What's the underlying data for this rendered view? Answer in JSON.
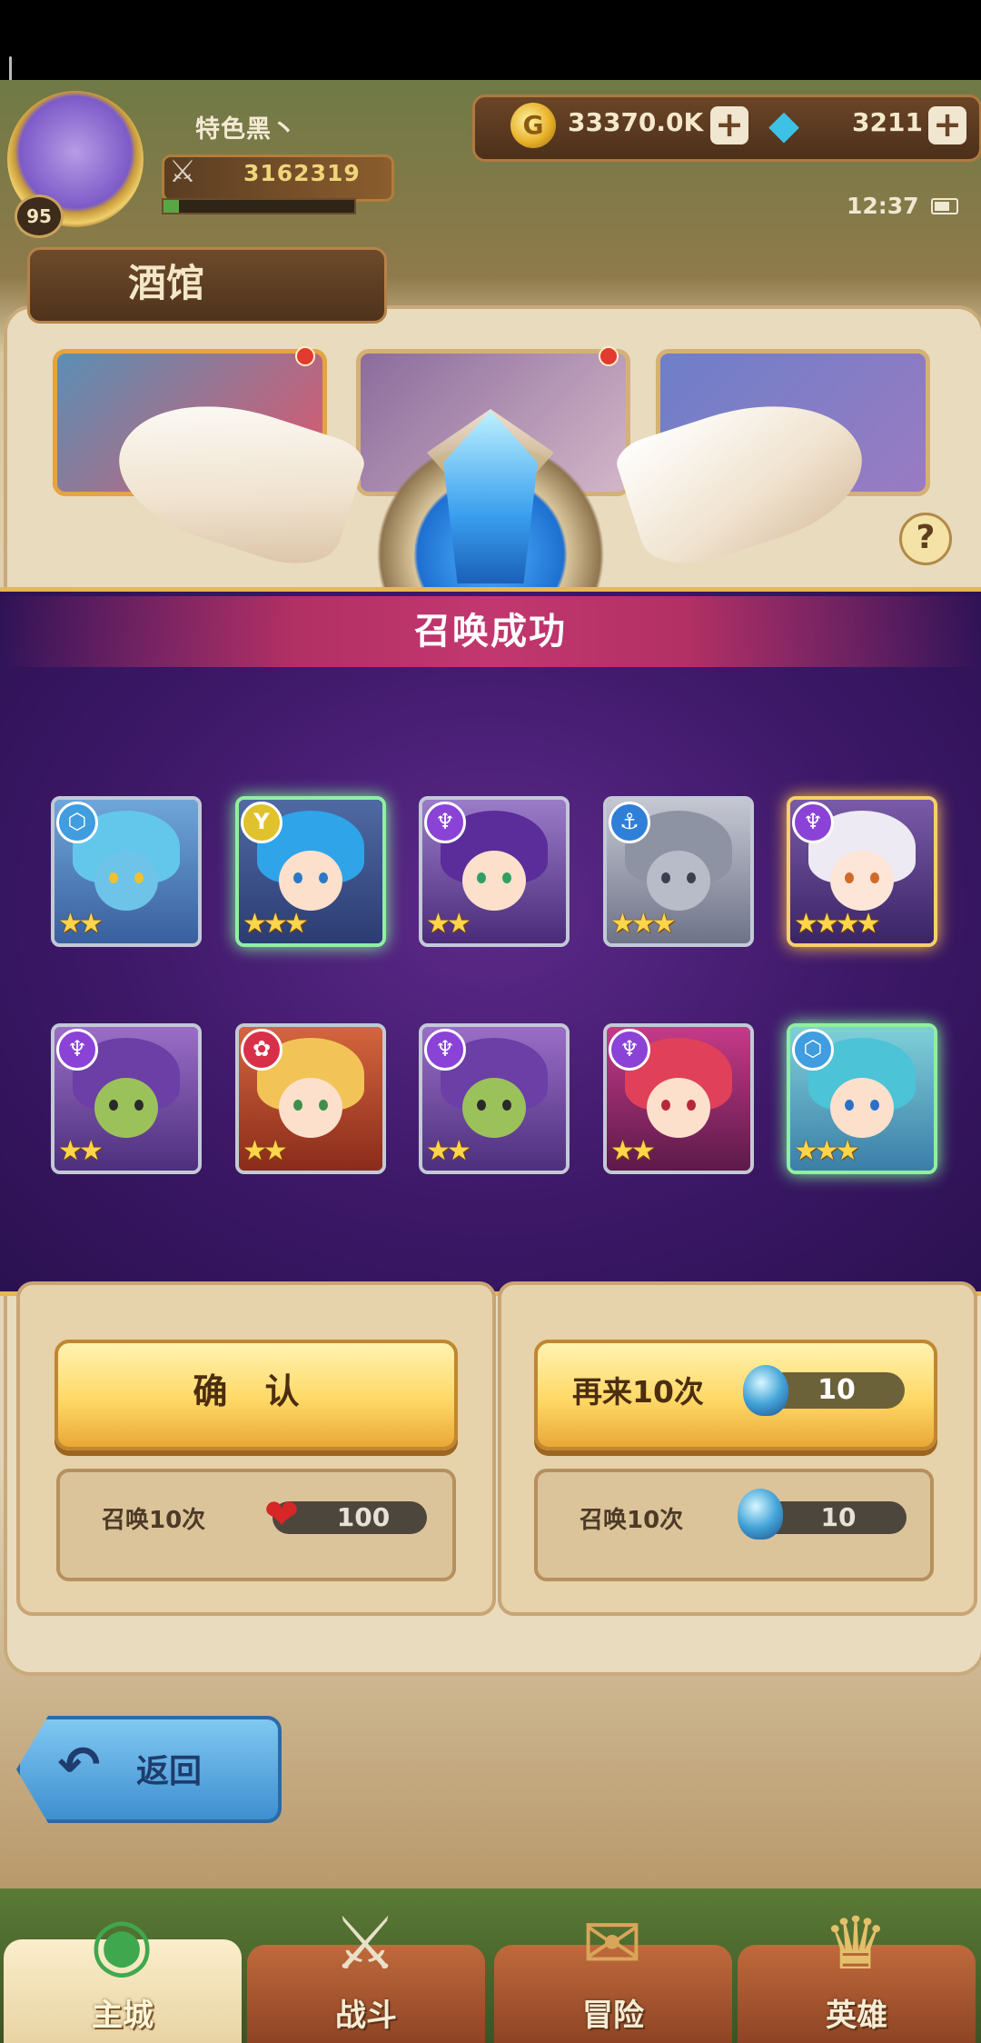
{
  "player": {
    "name": "特色黑丶",
    "level": "95",
    "power": "3162319",
    "xp_fraction": 0.08
  },
  "currency": {
    "gold": "33370.0K",
    "diamonds": "3211",
    "plus": "+"
  },
  "status": {
    "time": "12:37"
  },
  "tavern": {
    "title": "酒馆",
    "help": "?"
  },
  "modal": {
    "title": "召唤成功",
    "heroes": [
      {
        "faction": "water",
        "faction_glyph": "⬡",
        "faction_color": "#3f9de0",
        "stars": 2,
        "frame": "silver",
        "theme": "blue-monster"
      },
      {
        "faction": "light",
        "faction_glyph": "Y",
        "faction_color": "#e0c22c",
        "stars": 3,
        "frame": "green",
        "theme": "blue-hair-boy"
      },
      {
        "faction": "dark",
        "faction_glyph": "♆",
        "faction_color": "#8a43d6",
        "stars": 2,
        "frame": "silver",
        "theme": "purple-hair-girl"
      },
      {
        "faction": "anchor",
        "faction_glyph": "⚓",
        "faction_color": "#2f7fd9",
        "stars": 3,
        "frame": "silver",
        "theme": "knight"
      },
      {
        "faction": "dark",
        "faction_glyph": "♆",
        "faction_color": "#8a43d6",
        "stars": 4,
        "frame": "gold",
        "theme": "white-hair-girl"
      },
      {
        "faction": "dark",
        "faction_glyph": "♆",
        "faction_color": "#8a43d6",
        "stars": 2,
        "frame": "silver",
        "theme": "wizard"
      },
      {
        "faction": "fire",
        "faction_glyph": "✿",
        "faction_color": "#d9304a",
        "stars": 2,
        "frame": "silver",
        "theme": "blonde-boy"
      },
      {
        "faction": "dark",
        "faction_glyph": "♆",
        "faction_color": "#8a43d6",
        "stars": 2,
        "frame": "silver",
        "theme": "wizard"
      },
      {
        "faction": "dark",
        "faction_glyph": "♆",
        "faction_color": "#8a43d6",
        "stars": 2,
        "frame": "silver",
        "theme": "red-hair-girl"
      },
      {
        "faction": "water",
        "faction_glyph": "⬡",
        "faction_color": "#3f9de0",
        "stars": 3,
        "frame": "green",
        "theme": "blue-mage"
      }
    ]
  },
  "actions": {
    "confirm": "确 认",
    "again": "再来10次",
    "again_cost": "10",
    "summon_left": "召唤10次",
    "summon_left_cost": "100",
    "summon_right": "召唤10次",
    "summon_right_cost": "10",
    "back": "返回"
  },
  "nav": {
    "main": "主城",
    "battle": "战斗",
    "adventure": "冒险",
    "hero": "英雄"
  }
}
